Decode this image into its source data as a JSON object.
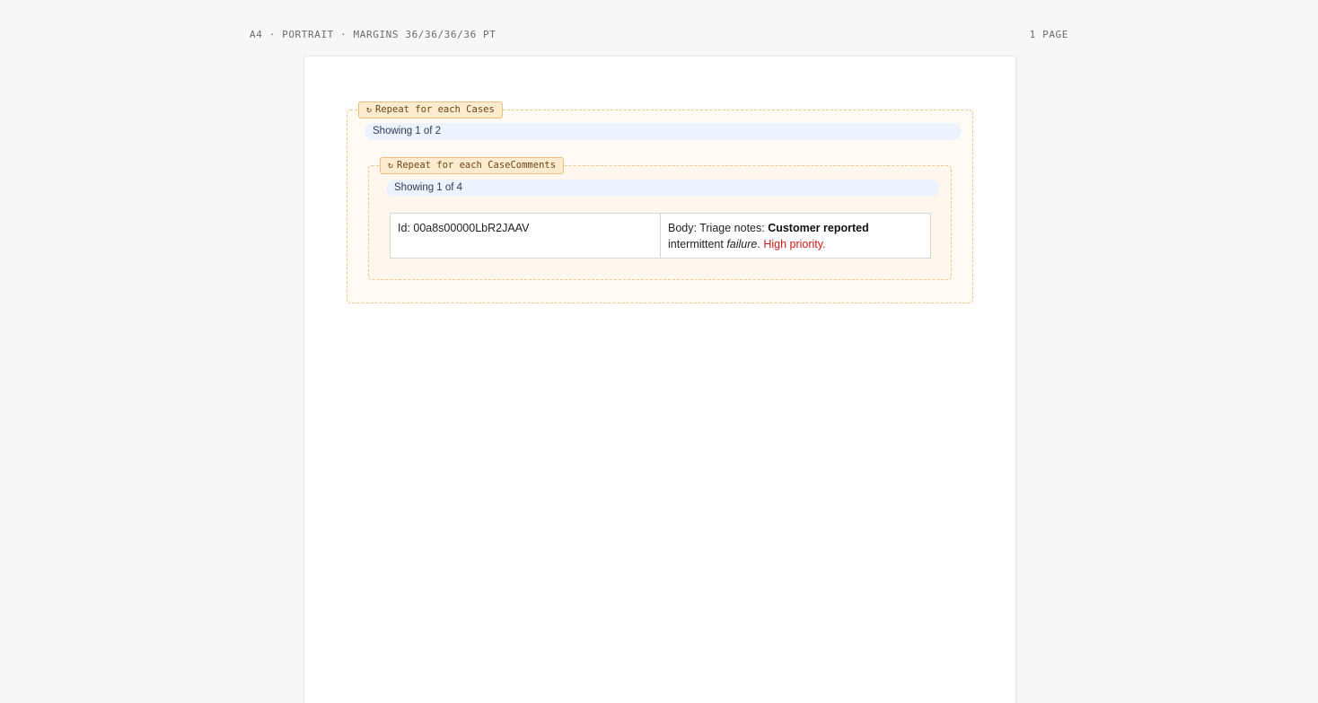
{
  "header": {
    "page_spec": "A4 · PORTRAIT · MARGINS 36/36/36/36 PT",
    "page_count": "1 PAGE"
  },
  "outer_repeat": {
    "icon": "loop-icon",
    "icon_glyph": "↻",
    "tag_label": "Repeat for each Cases",
    "showing": "Showing 1 of 2"
  },
  "inner_repeat": {
    "icon": "loop-icon",
    "icon_glyph": "↻",
    "tag_label": "Repeat for each CaseComments",
    "showing": "Showing 1 of 4"
  },
  "row": {
    "id_label": "Id: ",
    "id_value": "00a8s00000LbR2JAAV",
    "body_label": "Body: ",
    "body_plain": "Triage notes: ",
    "body_bold": "Customer reported",
    "body_mid": "intermittent ",
    "body_italic": "failure",
    "body_after_italic": ". ",
    "body_red": "High priority",
    "body_end": "."
  },
  "colors": {
    "repeat_border": "#f0c98a",
    "repeat_tag_bg": "#fdebcf",
    "showing_bg": "#edf3fe",
    "highlight_red": "#d11a1a"
  }
}
